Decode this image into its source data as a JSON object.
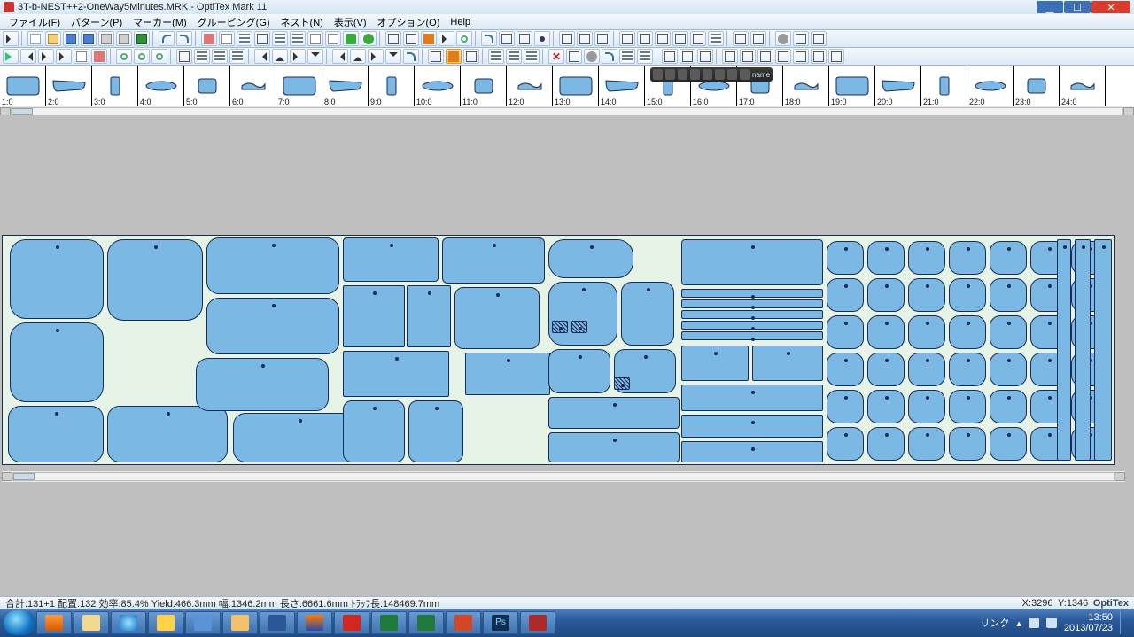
{
  "window": {
    "title": "3T-b-NEST++2-OneWay5Minutes.MRK - OptiTex Mark 11"
  },
  "menu": {
    "items": [
      "ファイル(F)",
      "パターン(P)",
      "マーカー(M)",
      "グルーピング(G)",
      "ネスト(N)",
      "表示(V)",
      "オプション(O)",
      "Help"
    ]
  },
  "palette": {
    "slots": [
      "1:0",
      "2:0",
      "3:0",
      "4:0",
      "5:0",
      "6:0",
      "7:0",
      "8:0",
      "9:0",
      "10:0",
      "11:0",
      "12:0",
      "13:0",
      "14:0",
      "15:0",
      "16:0",
      "17:0",
      "18:0",
      "19:0",
      "20:0",
      "21:0",
      "22:0",
      "23:0",
      "24:0"
    ]
  },
  "floatbar": {
    "label": "name"
  },
  "status": {
    "left": "合計:131+1  配置:132  効率:85.4%  Yield:466.3mm  幅:1346.2mm  長さ:6661.6mm  ﾄﾗｯﾌ長:148469.7mm",
    "coords_x_label": "X:",
    "coords_x": "3296",
    "coords_y_label": "Y:",
    "coords_y": "1346",
    "brand": "OptiTex"
  },
  "taskbar": {
    "tray_link": "リンク",
    "time": "13:50",
    "date": "2013/07/23"
  }
}
